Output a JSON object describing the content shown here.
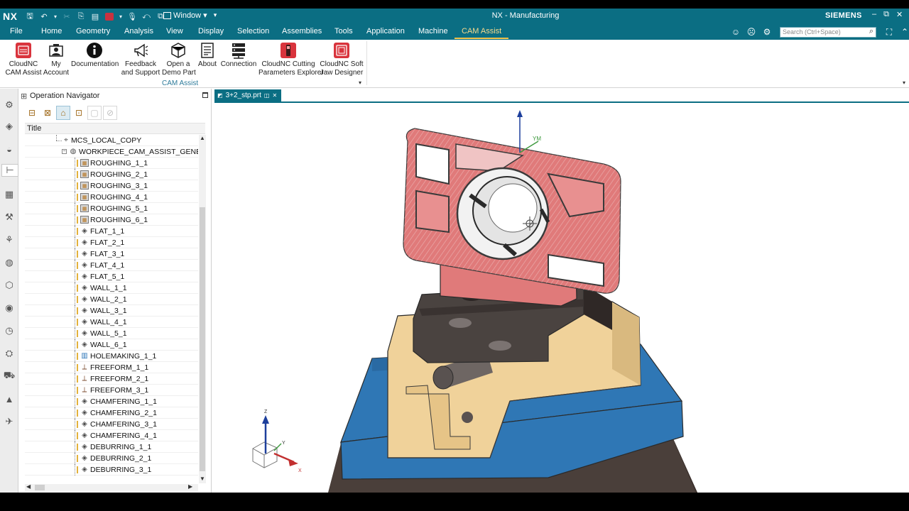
{
  "titlebar": {
    "logo": "NX",
    "window_menu": "Window ▾",
    "title": "NX - Manufacturing",
    "brand": "SIEMENS",
    "minimize": "–",
    "restore": "⧉",
    "close": "✕"
  },
  "menubar": {
    "tabs": [
      "File",
      "Home",
      "Geometry",
      "Analysis",
      "View",
      "Display",
      "Selection",
      "Assemblies",
      "Tools",
      "Application",
      "Machine",
      "CAM Assist"
    ],
    "active_tab": "CAM Assist",
    "search_placeholder": "Search (Ctrl+Space)"
  },
  "ribbon": {
    "group_label": "CAM Assist",
    "buttons": [
      {
        "label": "CloudNC\nCAM Assist",
        "icon": "cloudnc-cam-assist-icon"
      },
      {
        "label": "My\nAccount",
        "icon": "account-icon"
      },
      {
        "label": "Documentation",
        "icon": "info-icon"
      },
      {
        "label": "Feedback\nand Support",
        "icon": "megaphone-icon"
      },
      {
        "label": "Open a\nDemo Part",
        "icon": "cube-icon"
      },
      {
        "label": "About",
        "icon": "document-icon"
      },
      {
        "label": "Connection",
        "icon": "server-icon"
      },
      {
        "label": "CloudNC Cutting\nParameters Explorer",
        "icon": "cutting-params-icon"
      },
      {
        "label": "CloudNC Soft\nJaw Designer",
        "icon": "soft-jaw-icon"
      }
    ]
  },
  "navigator": {
    "title": "Operation Navigator",
    "column_title": "Title",
    "parents": [
      "MCS_LOCAL_COPY",
      "WORKPIECE_CAM_ASSIST_GENERATED"
    ],
    "operations": [
      {
        "name": "ROUGHING_1_1",
        "kind": "rough"
      },
      {
        "name": "ROUGHING_2_1",
        "kind": "rough"
      },
      {
        "name": "ROUGHING_3_1",
        "kind": "rough"
      },
      {
        "name": "ROUGHING_4_1",
        "kind": "rough"
      },
      {
        "name": "ROUGHING_5_1",
        "kind": "rough"
      },
      {
        "name": "ROUGHING_6_1",
        "kind": "rough"
      },
      {
        "name": "FLAT_1_1",
        "kind": "flat"
      },
      {
        "name": "FLAT_2_1",
        "kind": "flat"
      },
      {
        "name": "FLAT_3_1",
        "kind": "flat"
      },
      {
        "name": "FLAT_4_1",
        "kind": "flat"
      },
      {
        "name": "FLAT_5_1",
        "kind": "flat"
      },
      {
        "name": "WALL_1_1",
        "kind": "wall"
      },
      {
        "name": "WALL_2_1",
        "kind": "wall"
      },
      {
        "name": "WALL_3_1",
        "kind": "wall"
      },
      {
        "name": "WALL_4_1",
        "kind": "wall"
      },
      {
        "name": "WALL_5_1",
        "kind": "wall"
      },
      {
        "name": "WALL_6_1",
        "kind": "wall"
      },
      {
        "name": "HOLEMAKING_1_1",
        "kind": "hole"
      },
      {
        "name": "FREEFORM_1_1",
        "kind": "free"
      },
      {
        "name": "FREEFORM_2_1",
        "kind": "free"
      },
      {
        "name": "FREEFORM_3_1",
        "kind": "free"
      },
      {
        "name": "CHAMFERING_1_1",
        "kind": "chamfer"
      },
      {
        "name": "CHAMFERING_2_1",
        "kind": "chamfer"
      },
      {
        "name": "CHAMFERING_3_1",
        "kind": "chamfer"
      },
      {
        "name": "CHAMFERING_4_1",
        "kind": "chamfer"
      },
      {
        "name": "DEBURRING_1_1",
        "kind": "deburr"
      },
      {
        "name": "DEBURRING_2_1",
        "kind": "deburr"
      },
      {
        "name": "DEBURRING_3_1",
        "kind": "deburr"
      }
    ]
  },
  "graphics": {
    "doc_tab": "3+2_stp.prt",
    "axes": {
      "z": "Z",
      "y": "Y",
      "x": "X",
      "ym": "YM"
    },
    "colors": {
      "part": "#e07a7a",
      "fixture_tan": "#f0d29a",
      "vise_jaw": "#4a4340",
      "base_blue": "#2f77b5",
      "accent": "#0b6e83"
    }
  }
}
